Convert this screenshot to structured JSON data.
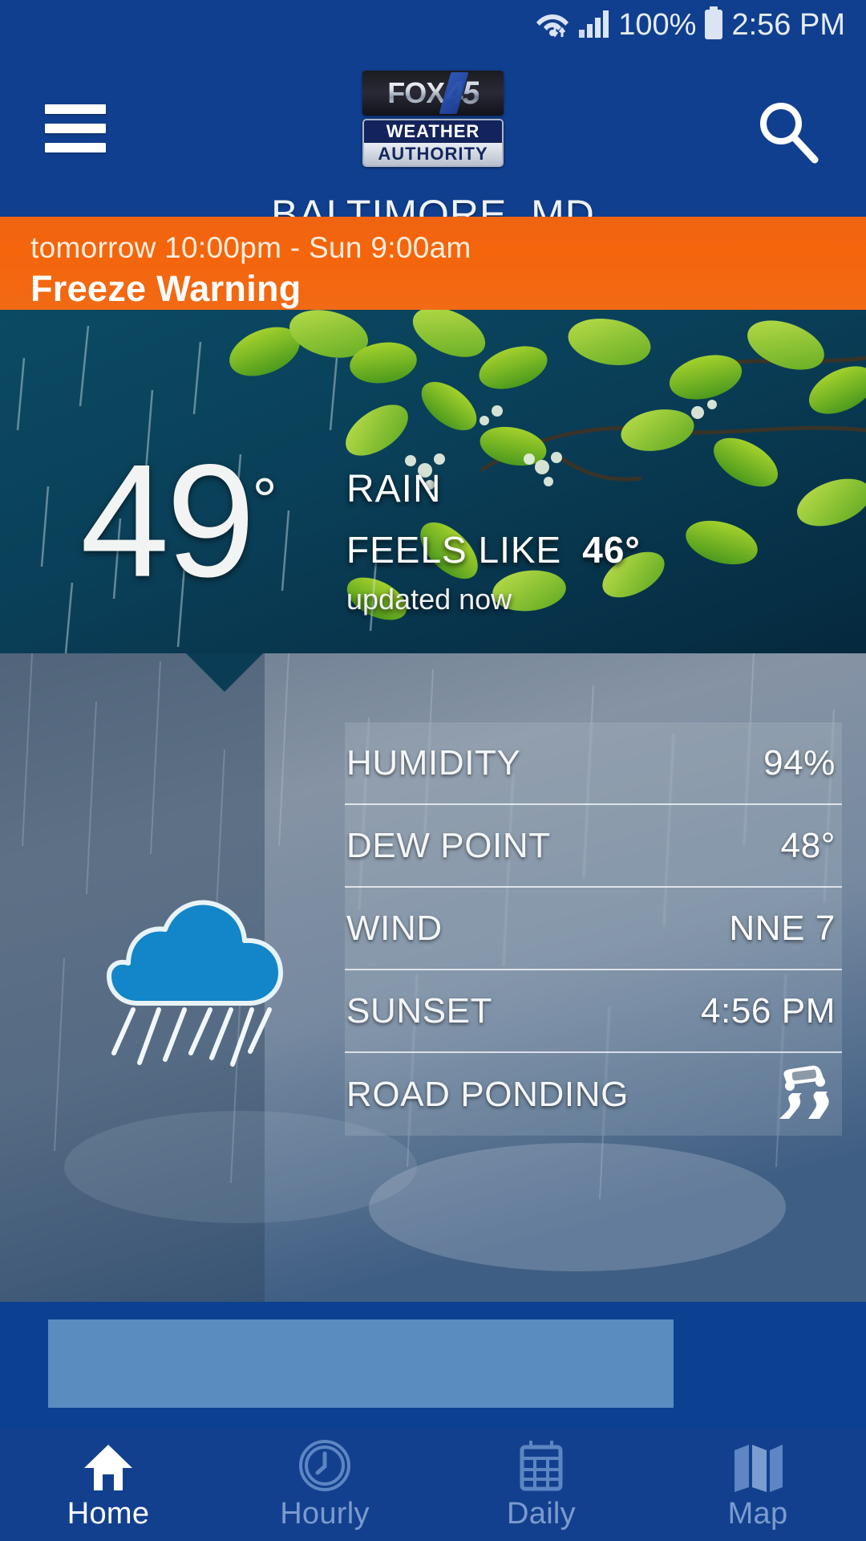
{
  "statusbar": {
    "wifi_icon": "wifi-icon",
    "signal_icon": "cellular-signal-icon",
    "battery_percent": "100%",
    "battery_icon": "battery-full-icon",
    "time": "2:56 PM"
  },
  "header": {
    "menu_icon": "hamburger-menu-icon",
    "search_icon": "search-icon",
    "logo": {
      "network": "FOX",
      "channel": "45",
      "line1": "WEATHER",
      "line2": "AUTHORITY"
    },
    "location": "BALTIMORE, MD"
  },
  "alert": {
    "timeframe": "tomorrow 10:00pm - Sun 9:00am",
    "title": "Freeze Warning",
    "color": "#f2650f"
  },
  "current": {
    "temperature": "49",
    "degree": "°",
    "condition": "RAIN",
    "feels_like_label": "FEELS LIKE",
    "feels_like_value": "46°",
    "updated": "updated now"
  },
  "details": {
    "condition_icon": "rain-cloud-icon",
    "rows": [
      {
        "label": "HUMIDITY",
        "value": "94%",
        "icon": ""
      },
      {
        "label": "DEW POINT",
        "value": "48°",
        "icon": ""
      },
      {
        "label": "WIND",
        "value": "NNE 7",
        "icon": ""
      },
      {
        "label": "SUNSET",
        "value": "4:56 PM",
        "icon": ""
      },
      {
        "label": "ROAD PONDING",
        "value": "",
        "icon": "slippery-road-icon"
      }
    ]
  },
  "nav": {
    "items": [
      {
        "label": "Home",
        "icon": "home-icon",
        "active": true
      },
      {
        "label": "Hourly",
        "icon": "clock-icon",
        "active": false
      },
      {
        "label": "Daily",
        "icon": "calendar-icon",
        "active": false
      },
      {
        "label": "Map",
        "icon": "map-icon",
        "active": false
      }
    ]
  },
  "colors": {
    "header_blue": "#103f8f",
    "alert_orange": "#f2650f",
    "nav_blue": "#13408e",
    "cloud_blue": "#1286c8"
  }
}
